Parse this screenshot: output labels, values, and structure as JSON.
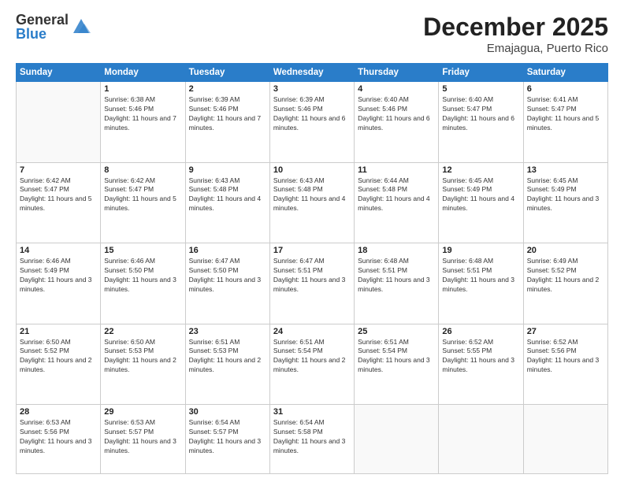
{
  "header": {
    "logo_general": "General",
    "logo_blue": "Blue",
    "month_title": "December 2025",
    "location": "Emajagua, Puerto Rico"
  },
  "days_of_week": [
    "Sunday",
    "Monday",
    "Tuesday",
    "Wednesday",
    "Thursday",
    "Friday",
    "Saturday"
  ],
  "weeks": [
    [
      {
        "day": "",
        "info": ""
      },
      {
        "day": "1",
        "info": "Sunrise: 6:38 AM\nSunset: 5:46 PM\nDaylight: 11 hours and 7 minutes."
      },
      {
        "day": "2",
        "info": "Sunrise: 6:39 AM\nSunset: 5:46 PM\nDaylight: 11 hours and 7 minutes."
      },
      {
        "day": "3",
        "info": "Sunrise: 6:39 AM\nSunset: 5:46 PM\nDaylight: 11 hours and 6 minutes."
      },
      {
        "day": "4",
        "info": "Sunrise: 6:40 AM\nSunset: 5:46 PM\nDaylight: 11 hours and 6 minutes."
      },
      {
        "day": "5",
        "info": "Sunrise: 6:40 AM\nSunset: 5:47 PM\nDaylight: 11 hours and 6 minutes."
      },
      {
        "day": "6",
        "info": "Sunrise: 6:41 AM\nSunset: 5:47 PM\nDaylight: 11 hours and 5 minutes."
      }
    ],
    [
      {
        "day": "7",
        "info": "Sunrise: 6:42 AM\nSunset: 5:47 PM\nDaylight: 11 hours and 5 minutes."
      },
      {
        "day": "8",
        "info": "Sunrise: 6:42 AM\nSunset: 5:47 PM\nDaylight: 11 hours and 5 minutes."
      },
      {
        "day": "9",
        "info": "Sunrise: 6:43 AM\nSunset: 5:48 PM\nDaylight: 11 hours and 4 minutes."
      },
      {
        "day": "10",
        "info": "Sunrise: 6:43 AM\nSunset: 5:48 PM\nDaylight: 11 hours and 4 minutes."
      },
      {
        "day": "11",
        "info": "Sunrise: 6:44 AM\nSunset: 5:48 PM\nDaylight: 11 hours and 4 minutes."
      },
      {
        "day": "12",
        "info": "Sunrise: 6:45 AM\nSunset: 5:49 PM\nDaylight: 11 hours and 4 minutes."
      },
      {
        "day": "13",
        "info": "Sunrise: 6:45 AM\nSunset: 5:49 PM\nDaylight: 11 hours and 3 minutes."
      }
    ],
    [
      {
        "day": "14",
        "info": "Sunrise: 6:46 AM\nSunset: 5:49 PM\nDaylight: 11 hours and 3 minutes."
      },
      {
        "day": "15",
        "info": "Sunrise: 6:46 AM\nSunset: 5:50 PM\nDaylight: 11 hours and 3 minutes."
      },
      {
        "day": "16",
        "info": "Sunrise: 6:47 AM\nSunset: 5:50 PM\nDaylight: 11 hours and 3 minutes."
      },
      {
        "day": "17",
        "info": "Sunrise: 6:47 AM\nSunset: 5:51 PM\nDaylight: 11 hours and 3 minutes."
      },
      {
        "day": "18",
        "info": "Sunrise: 6:48 AM\nSunset: 5:51 PM\nDaylight: 11 hours and 3 minutes."
      },
      {
        "day": "19",
        "info": "Sunrise: 6:48 AM\nSunset: 5:51 PM\nDaylight: 11 hours and 3 minutes."
      },
      {
        "day": "20",
        "info": "Sunrise: 6:49 AM\nSunset: 5:52 PM\nDaylight: 11 hours and 2 minutes."
      }
    ],
    [
      {
        "day": "21",
        "info": "Sunrise: 6:50 AM\nSunset: 5:52 PM\nDaylight: 11 hours and 2 minutes."
      },
      {
        "day": "22",
        "info": "Sunrise: 6:50 AM\nSunset: 5:53 PM\nDaylight: 11 hours and 2 minutes."
      },
      {
        "day": "23",
        "info": "Sunrise: 6:51 AM\nSunset: 5:53 PM\nDaylight: 11 hours and 2 minutes."
      },
      {
        "day": "24",
        "info": "Sunrise: 6:51 AM\nSunset: 5:54 PM\nDaylight: 11 hours and 2 minutes."
      },
      {
        "day": "25",
        "info": "Sunrise: 6:51 AM\nSunset: 5:54 PM\nDaylight: 11 hours and 3 minutes."
      },
      {
        "day": "26",
        "info": "Sunrise: 6:52 AM\nSunset: 5:55 PM\nDaylight: 11 hours and 3 minutes."
      },
      {
        "day": "27",
        "info": "Sunrise: 6:52 AM\nSunset: 5:56 PM\nDaylight: 11 hours and 3 minutes."
      }
    ],
    [
      {
        "day": "28",
        "info": "Sunrise: 6:53 AM\nSunset: 5:56 PM\nDaylight: 11 hours and 3 minutes."
      },
      {
        "day": "29",
        "info": "Sunrise: 6:53 AM\nSunset: 5:57 PM\nDaylight: 11 hours and 3 minutes."
      },
      {
        "day": "30",
        "info": "Sunrise: 6:54 AM\nSunset: 5:57 PM\nDaylight: 11 hours and 3 minutes."
      },
      {
        "day": "31",
        "info": "Sunrise: 6:54 AM\nSunset: 5:58 PM\nDaylight: 11 hours and 3 minutes."
      },
      {
        "day": "",
        "info": ""
      },
      {
        "day": "",
        "info": ""
      },
      {
        "day": "",
        "info": ""
      }
    ]
  ]
}
